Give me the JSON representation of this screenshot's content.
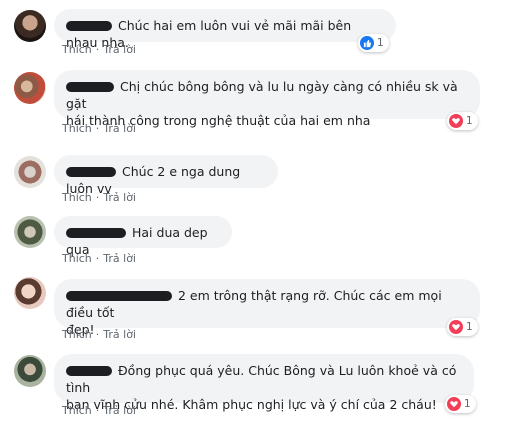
{
  "labels": {
    "like": "Thích",
    "reply": "Trả lời",
    "sep": "·"
  },
  "colors": {
    "like_blue": "#1877f2",
    "heart_red": "#f33e58",
    "bubble_bg": "#f2f3f5"
  },
  "comments": [
    {
      "text": "Chúc hai em luôn vui vẻ mãi mãi bên nhau nha.",
      "reaction": {
        "icon": "like-icon",
        "count": "1"
      }
    },
    {
      "text_1": "Chị chúc bông bông và lu lu ngày càng có nhiều sk và gặt",
      "text_2": "hái thành công trong nghệ thuật của hai em nha",
      "reaction": {
        "icon": "heart-icon",
        "count": "1"
      }
    },
    {
      "text": "Chúc 2 e nga dung luôn vv"
    },
    {
      "text": "Hai dua dep qua"
    },
    {
      "text_1": "2 em trông thật rạng rỡ. Chúc các em mọi điều tốt",
      "text_2": "đẹp!",
      "reaction": {
        "icon": "heart-icon",
        "count": "1"
      }
    },
    {
      "text_1": "Đồng phục quá yêu. Chúc Bông và Lu luôn khoẻ và có tình",
      "text_2": "bạn vĩnh cửu nhé. Khâm phục nghị lực và ý chí của 2 cháu!",
      "reaction": {
        "icon": "heart-icon",
        "count": "1"
      }
    }
  ]
}
